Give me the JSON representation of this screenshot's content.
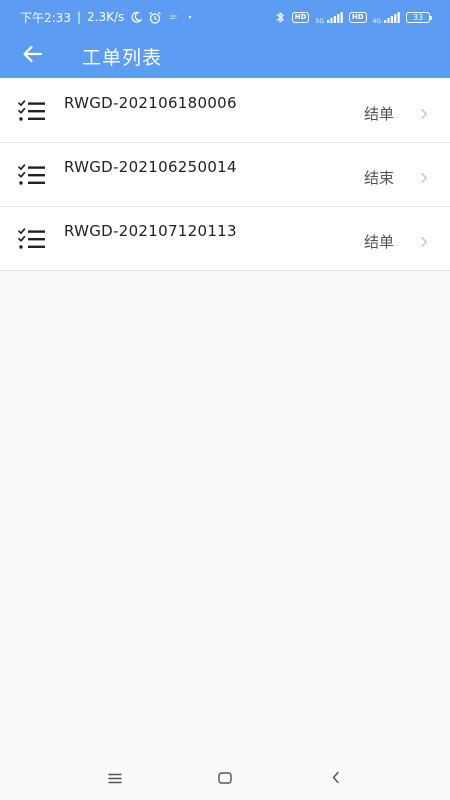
{
  "status_bar": {
    "time": "下午2:33",
    "separator": "|",
    "net_speed": "2.3K/s",
    "hd_label_1": "HD",
    "net_1": "5G",
    "hd_label_2": "HD",
    "net_2": "4G",
    "battery": "33"
  },
  "header": {
    "title": "工单列表"
  },
  "work_orders": [
    {
      "id": "RWGD-202106180006",
      "status": "结单"
    },
    {
      "id": "RWGD-202106250014",
      "status": "结束"
    },
    {
      "id": "RWGD-202107120113",
      "status": "结单"
    }
  ],
  "colors": {
    "primary": "#5d9cf3",
    "background": "#fafafa",
    "divider": "#e6e6e6"
  }
}
